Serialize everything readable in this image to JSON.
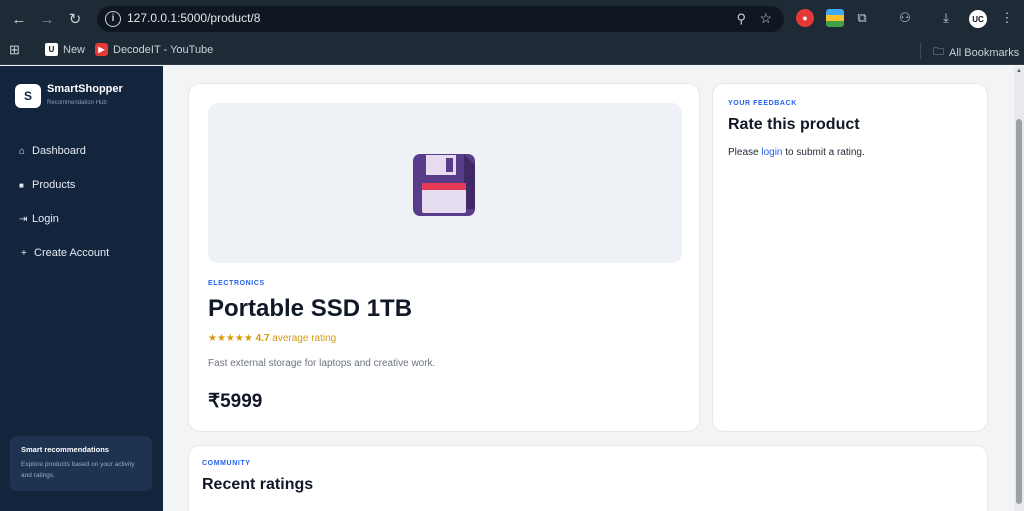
{
  "browser": {
    "url": "127.0.0.1:5000/product/8",
    "bookmarks": [
      {
        "label": "New",
        "icon": "uc-icon"
      },
      {
        "label": "DecodeIT - YouTube",
        "icon": "youtube-icon"
      }
    ],
    "all_bookmarks": "All Bookmarks",
    "profile_initials": "UC"
  },
  "sidebar": {
    "logo_letter": "S",
    "brand": "SmartShopper",
    "brand_sub": "Recommendation Hub",
    "nav": [
      {
        "icon": "home-icon",
        "glyph": "⌂",
        "label": "Dashboard"
      },
      {
        "icon": "grid-icon",
        "glyph": "■",
        "label": "Products"
      },
      {
        "icon": "login-icon",
        "glyph": "⇥",
        "label": "Login"
      },
      {
        "icon": "plus-icon",
        "glyph": "+",
        "label": "Create Account"
      }
    ],
    "promo": {
      "title": "Smart recommendations",
      "text": "Explore products based on your activity and ratings."
    }
  },
  "product": {
    "category": "ELECTRONICS",
    "name": "Portable SSD 1TB",
    "stars": "★★★★★",
    "rating_value": "4.7",
    "rating_label": "average rating",
    "description": "Fast external storage for laptops and creative work.",
    "price": "₹5999",
    "image_icon": "floppy-disk-icon"
  },
  "feedback": {
    "eyebrow": "YOUR FEEDBACK",
    "title": "Rate this product",
    "text_before": "Please ",
    "link": "login",
    "text_after": " to submit a rating."
  },
  "community": {
    "eyebrow": "COMMUNITY",
    "title": "Recent ratings"
  },
  "colors": {
    "sidebar_bg": "#13243d",
    "accent": "#2563eb",
    "star": "#d39b0c"
  }
}
